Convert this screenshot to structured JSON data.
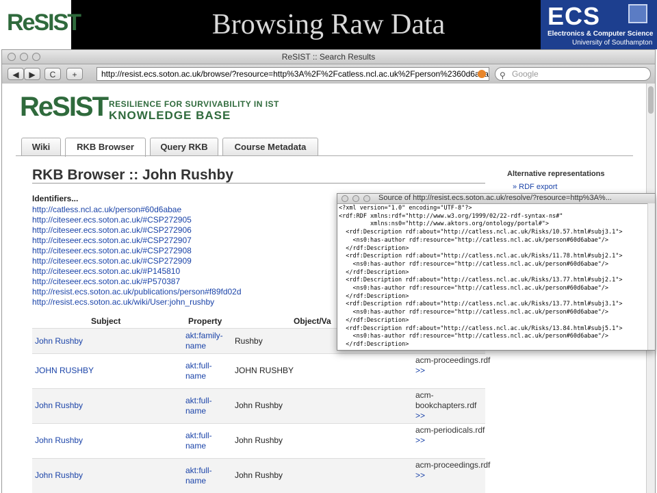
{
  "slide": {
    "title": "Browsing Raw Data",
    "resist_logo": "ReSIST",
    "ecs_logo": "ECS",
    "ecs_line1": "Electronics & Computer Science",
    "ecs_line2": "University of Southampton"
  },
  "browser": {
    "window_title": "ReSIST :: Search Results",
    "back_label": "◀",
    "forward_label": "▶",
    "reload_label": "C",
    "add_label": "+",
    "url": "http://resist.ecs.soton.ac.uk/browse/?resource=http%3A%2F%2Fcatless.ncl.ac.uk%2Fperson%2360d6abae",
    "search_placeholder": "Google"
  },
  "kb": {
    "logo": "ReSIST",
    "line1": "RESILIENCE FOR SURVIVABILITY IN IST",
    "line2": "KNOWLEDGE BASE"
  },
  "tabs": [
    "Wiki",
    "RKB Browser",
    "Query RKB",
    "Course Metadata"
  ],
  "page": {
    "heading": "RKB Browser :: John Rushby",
    "alt_title": "Alternative representations",
    "alt_link": "» RDF export",
    "identifiers_heading": "Identifiers...",
    "identifiers": [
      "http://catless.ncl.ac.uk/person#60d6abae",
      "http://citeseer.ecs.soton.ac.uk/#CSP272905",
      "http://citeseer.ecs.soton.ac.uk/#CSP272906",
      "http://citeseer.ecs.soton.ac.uk/#CSP272907",
      "http://citeseer.ecs.soton.ac.uk/#CSP272908",
      "http://citeseer.ecs.soton.ac.uk/#CSP272909",
      "http://citeseer.ecs.soton.ac.uk/#P145810",
      "http://citeseer.ecs.soton.ac.uk/#P570387",
      "http://resist.ecs.soton.ac.uk/publications/person#f89fd02d",
      "http://resist.ecs.soton.ac.uk/wiki/User:john_rushby"
    ],
    "table": {
      "headers": {
        "subject": "Subject",
        "property": "Property",
        "object": "Object/Va"
      },
      "rows": [
        {
          "subject": "John Rushby",
          "property": "akt:family-name",
          "object": "Rushby",
          "source": "",
          "more": ""
        },
        {
          "subject": "JOHN RUSHBY",
          "property": "akt:full-name",
          "object": "JOHN RUSHBY",
          "source": "acm-proceedings.rdf",
          "more": ">>"
        },
        {
          "subject": "John Rushby",
          "property": "akt:full-name",
          "object": "John Rushby",
          "source": "acm-bookchapters.rdf",
          "more": ">>"
        },
        {
          "subject": "John Rushby",
          "property": "akt:full-name",
          "object": "John Rushby",
          "source": "acm-periodicals.rdf",
          "more": ">>"
        },
        {
          "subject": "John Rushby",
          "property": "akt:full-name",
          "object": "John Rushby",
          "source": "acm-proceedings.rdf",
          "more": ">>"
        }
      ]
    }
  },
  "popup": {
    "title": "Source of http://resist.ecs.soton.ac.uk/resolve/?resource=http%3A%...",
    "code": "<?xml version=\"1.0\" encoding=\"UTF-8\"?>\n<rdf:RDF xmlns:rdf=\"http://www.w3.org/1999/02/22-rdf-syntax-ns#\"\n         xmlns:ns0=\"http://www.aktors.org/ontology/portal#\">\n  <rdf:Description rdf:about=\"http://catless.ncl.ac.uk/Risks/10.57.html#subj3.1\">\n    <ns0:has-author rdf:resource=\"http://catless.ncl.ac.uk/person#60d6abae\"/>\n  </rdf:Description>\n  <rdf:Description rdf:about=\"http://catless.ncl.ac.uk/Risks/11.78.html#subj2.1\">\n    <ns0:has-author rdf:resource=\"http://catless.ncl.ac.uk/person#60d6abae\"/>\n  </rdf:Description>\n  <rdf:Description rdf:about=\"http://catless.ncl.ac.uk/Risks/13.77.html#subj2.1\">\n    <ns0:has-author rdf:resource=\"http://catless.ncl.ac.uk/person#60d6abae\"/>\n  </rdf:Description>\n  <rdf:Description rdf:about=\"http://catless.ncl.ac.uk/Risks/13.77.html#subj3.1\">\n    <ns0:has-author rdf:resource=\"http://catless.ncl.ac.uk/person#60d6abae\"/>\n  </rdf:Description>\n  <rdf:Description rdf:about=\"http://catless.ncl.ac.uk/Risks/13.84.html#subj5.1\">\n    <ns0:has-author rdf:resource=\"http://catless.ncl.ac.uk/person#60d6abae\"/>\n  </rdf:Description>"
  },
  "colors": {
    "brand_green": "#2f6a3c",
    "link_blue": "#1a43a8",
    "ecs_blue": "#1d3f8f"
  }
}
